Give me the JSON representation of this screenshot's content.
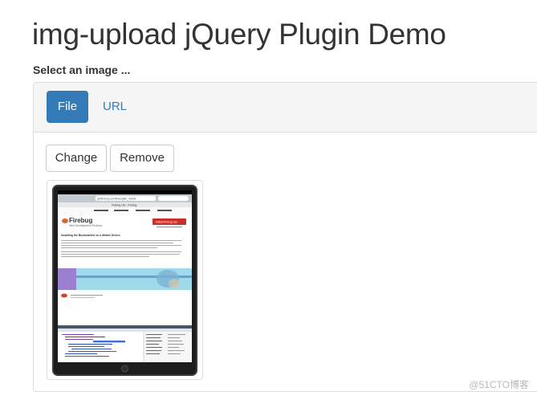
{
  "page": {
    "title": "img-upload jQuery Plugin Demo",
    "select_label": "Select an image ..."
  },
  "tabs": [
    {
      "label": "File",
      "active": true
    },
    {
      "label": "URL",
      "active": false
    }
  ],
  "actions": {
    "change_label": "Change",
    "remove_label": "Remove"
  },
  "preview": {
    "browser_url": "getfirebug.com/firebuglite_mobile",
    "browser_tab_title": "Firebug Lite : Firebug",
    "firebug_logo": "Firebug",
    "firebug_tagline": "Web Development Evolved.",
    "install_button": "Install Firebug Lite",
    "section_heading": "Installing the Bookmarklet on a Mobile Device"
  },
  "watermark": "@51CTO博客",
  "colors": {
    "accent": "#337ab7",
    "panel_bg": "#f5f5f5",
    "border": "#dddddd"
  }
}
